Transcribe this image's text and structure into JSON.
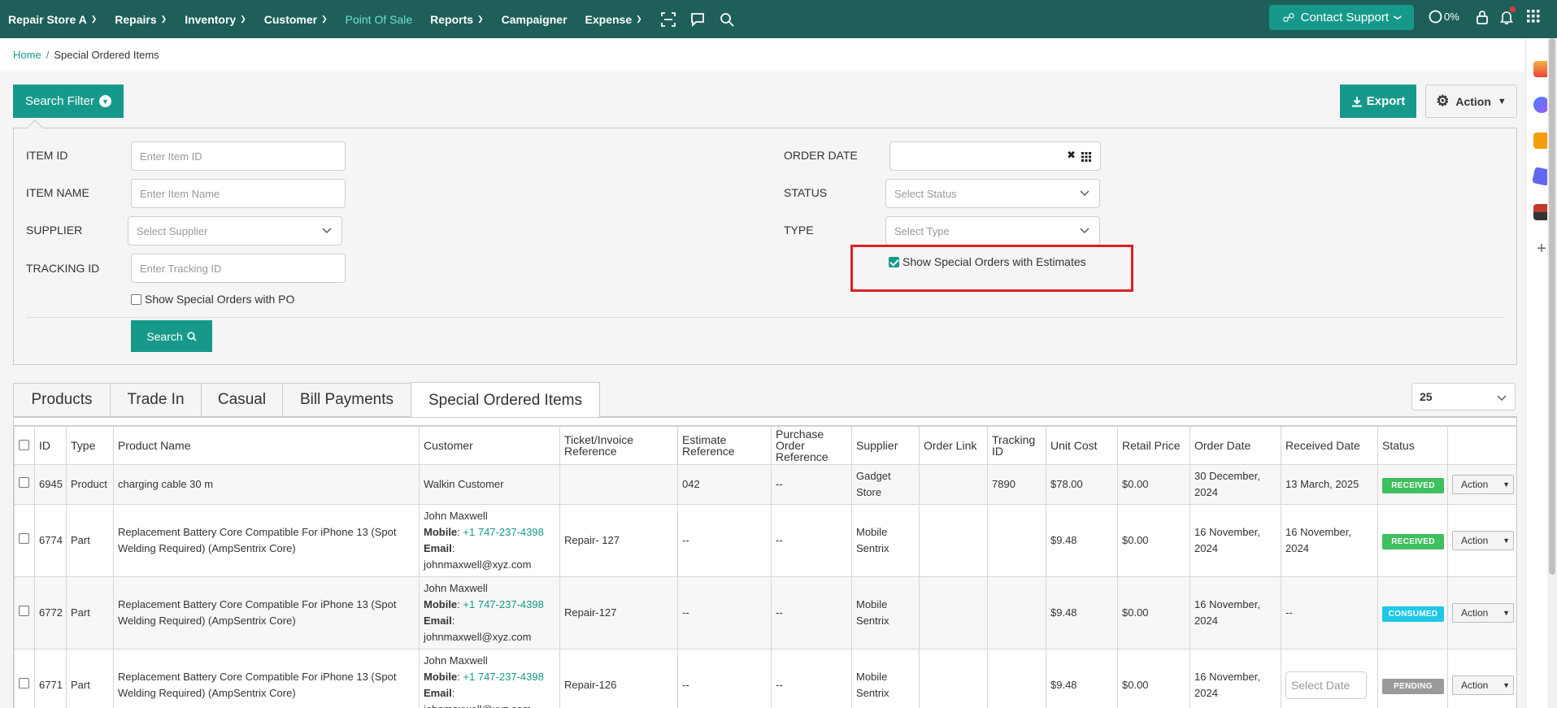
{
  "nav": {
    "store": "Repair Store A",
    "repairs": "Repairs",
    "inventory": "Inventory",
    "customer": "Customer",
    "pos": "Point Of Sale",
    "reports": "Reports",
    "campaigner": "Campaigner",
    "expense": "Expense",
    "support": "Contact Support",
    "progress": "0%"
  },
  "breadcrumb": {
    "home": "Home",
    "sep": "/",
    "current": "Special Ordered Items"
  },
  "toolbar": {
    "search_filter": "Search Filter",
    "export": "Export",
    "action": "Action"
  },
  "filters": {
    "item_id_label": "ITEM ID",
    "item_id_placeholder": "Enter Item ID",
    "item_name_label": "ITEM NAME",
    "item_name_placeholder": "Enter Item Name",
    "supplier_label": "SUPPLIER",
    "supplier_placeholder": "Select Supplier",
    "tracking_label": "TRACKING ID",
    "tracking_placeholder": "Enter Tracking ID",
    "show_po": "Show Special Orders with PO",
    "order_date_label": "ORDER DATE",
    "status_label": "STATUS",
    "status_placeholder": "Select Status",
    "type_label": "TYPE",
    "type_placeholder": "Select Type",
    "show_estimates": "Show Special Orders with Estimates",
    "search": "Search"
  },
  "tabs": [
    "Products",
    "Trade In",
    "Casual",
    "Bill Payments",
    "Special Ordered Items"
  ],
  "page_size": "25",
  "table": {
    "headers": {
      "id": "ID",
      "type": "Type",
      "product": "Product Name",
      "customer": "Customer",
      "ticket": "Ticket/Invoice Reference",
      "estimate": "Estimate Reference",
      "po": "Purchase Order Reference",
      "supplier": "Supplier",
      "order_link": "Order Link",
      "tracking": "Tracking ID",
      "unit_cost": "Unit Cost",
      "retail": "Retail Price",
      "order_date": "Order Date",
      "received_date": "Received Date",
      "status": "Status"
    },
    "rows": [
      {
        "id": "6945",
        "type": "Product",
        "product": "charging cable 30 m",
        "customer_name": "Walkin Customer",
        "ticket": "",
        "estimate": "042",
        "po": "--",
        "supplier": "Gadget Store",
        "order_link": "",
        "tracking": "7890",
        "unit_cost": "$78.00",
        "retail": "$0.00",
        "order_date": "30 December, 2024",
        "received_date": "13 March, 2025",
        "status": "RECEIVED",
        "status_color": "#3fbf5e",
        "action": "Action"
      },
      {
        "id": "6774",
        "type": "Part",
        "product": "Replacement Battery Core Compatible For iPhone 13 (Spot Welding Required) (AmpSentrix Core)",
        "customer_name": "John Maxwell",
        "mobile_label": "Mobile",
        "mobile": "+1 747-237-4398",
        "email_label": "Email",
        "email": "johnmaxwell@xyz.com",
        "ticket": "Repair- 127",
        "estimate": "--",
        "po": "--",
        "supplier": "Mobile Sentrix",
        "order_link": "",
        "tracking": "",
        "unit_cost": "$9.48",
        "retail": "$0.00",
        "order_date": "16 November, 2024",
        "received_date": "16 November, 2024",
        "status": "RECEIVED",
        "status_color": "#3fbf5e",
        "action": "Action"
      },
      {
        "id": "6772",
        "type": "Part",
        "product": "Replacement Battery Core Compatible For iPhone 13 (Spot Welding Required) (AmpSentrix Core)",
        "customer_name": "John Maxwell",
        "mobile_label": "Mobile",
        "mobile": "+1 747-237-4398",
        "email_label": "Email",
        "email": "johnmaxwell@xyz.com",
        "ticket": "Repair-127",
        "estimate": "--",
        "po": "--",
        "supplier": "Mobile Sentrix",
        "order_link": "",
        "tracking": "",
        "unit_cost": "$9.48",
        "retail": "$0.00",
        "order_date": "16 November, 2024",
        "received_date": "--",
        "status": "CONSUMED",
        "status_color": "#1ec8e8",
        "action": "Action"
      },
      {
        "id": "6771",
        "type": "Part",
        "product": "Replacement Battery Core Compatible For iPhone 13 (Spot Welding Required) (AmpSentrix Core)",
        "customer_name": "John Maxwell",
        "mobile_label": "Mobile",
        "mobile": "+1 747-237-4398",
        "email_label": "Email",
        "email": "johnmaxwell@xyz.com",
        "ticket": "Repair-126",
        "estimate": "--",
        "po": "--",
        "supplier": "Mobile Sentrix",
        "order_link": "",
        "tracking": "",
        "unit_cost": "$9.48",
        "retail": "$0.00",
        "order_date": "16 November, 2024",
        "received_date_placeholder": "Select Date",
        "status": "PENDING",
        "status_color": "#9a9a9a",
        "action": "Action"
      }
    ]
  },
  "colors": {
    "nav_bg": "#1e5f5a",
    "accent": "#16998a",
    "highlight": "#e02020"
  }
}
